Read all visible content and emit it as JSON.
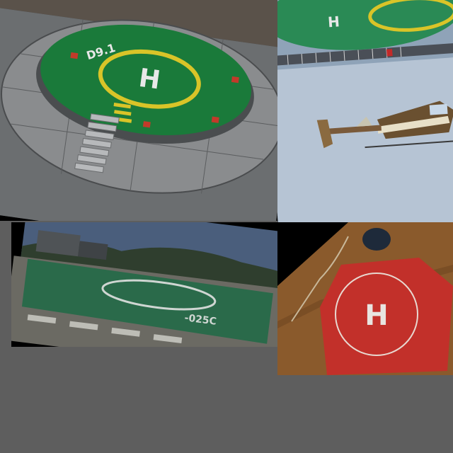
{
  "collage": {
    "background_color": "#5e5e5e",
    "panels": [
      {
        "id": "rooftop-helipad-render",
        "pad_marking": "H",
        "pad_label": "D9.1",
        "pad_color": "#1a7a3a",
        "ring_color": "#d9c428"
      },
      {
        "id": "helicopter-landing",
        "pad_marking": "H"
      },
      {
        "id": "ground-helipad-photo",
        "pad_label": "-025C"
      },
      {
        "id": "indoor-helipad-mat",
        "pad_marking": "H",
        "pad_color": "#c2302a"
      }
    ]
  }
}
